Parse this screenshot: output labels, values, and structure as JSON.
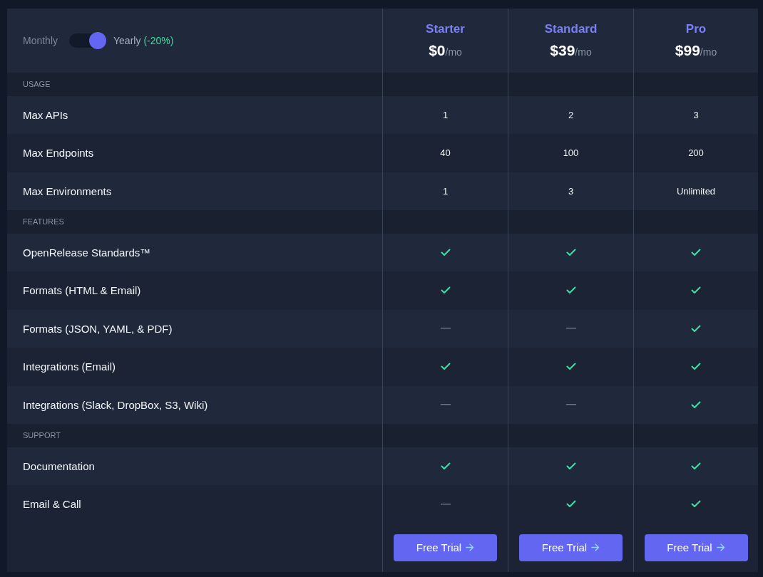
{
  "billing_toggle": {
    "left_label": "Monthly",
    "right_label": "Yearly",
    "discount": "(-20%)",
    "on": true
  },
  "plans": [
    {
      "name": "Starter",
      "price": "$0",
      "period": "/mo",
      "button": "Free Trial"
    },
    {
      "name": "Standard",
      "price": "$39",
      "period": "/mo",
      "button": "Free Trial"
    },
    {
      "name": "Pro",
      "price": "$99",
      "period": "/mo",
      "button": "Free Trial"
    }
  ],
  "sections": [
    {
      "title": "USAGE",
      "rows": [
        {
          "label": "Max APIs",
          "cells": [
            {
              "kind": "text",
              "text": "1"
            },
            {
              "kind": "text",
              "text": "2"
            },
            {
              "kind": "text",
              "text": "3"
            }
          ]
        },
        {
          "label": "Max Endpoints",
          "cells": [
            {
              "kind": "text",
              "text": "40"
            },
            {
              "kind": "text",
              "text": "100"
            },
            {
              "kind": "text",
              "text": "200"
            }
          ]
        },
        {
          "label": "Max Environments",
          "cells": [
            {
              "kind": "text",
              "text": "1"
            },
            {
              "kind": "text",
              "text": "3"
            },
            {
              "kind": "text",
              "text": "Unlimited"
            }
          ]
        }
      ]
    },
    {
      "title": "FEATURES",
      "rows": [
        {
          "label": "OpenRelease Standards™",
          "cells": [
            {
              "kind": "check"
            },
            {
              "kind": "check"
            },
            {
              "kind": "check"
            }
          ]
        },
        {
          "label": "Formats (HTML & Email)",
          "cells": [
            {
              "kind": "check"
            },
            {
              "kind": "check"
            },
            {
              "kind": "check"
            }
          ]
        },
        {
          "label": "Formats (JSON, YAML, & PDF)",
          "cells": [
            {
              "kind": "dash"
            },
            {
              "kind": "dash"
            },
            {
              "kind": "check"
            }
          ]
        },
        {
          "label": "Integrations (Email)",
          "cells": [
            {
              "kind": "check"
            },
            {
              "kind": "check"
            },
            {
              "kind": "check"
            }
          ]
        },
        {
          "label": "Integrations (Slack, DropBox, S3, Wiki)",
          "cells": [
            {
              "kind": "dash"
            },
            {
              "kind": "dash"
            },
            {
              "kind": "check"
            }
          ]
        }
      ]
    },
    {
      "title": "SUPPORT",
      "rows": [
        {
          "label": "Documentation",
          "cells": [
            {
              "kind": "check"
            },
            {
              "kind": "check"
            },
            {
              "kind": "check"
            }
          ]
        },
        {
          "label": "Email & Call",
          "cells": [
            {
              "kind": "dash"
            },
            {
              "kind": "check"
            },
            {
              "kind": "check"
            }
          ]
        }
      ]
    }
  ]
}
